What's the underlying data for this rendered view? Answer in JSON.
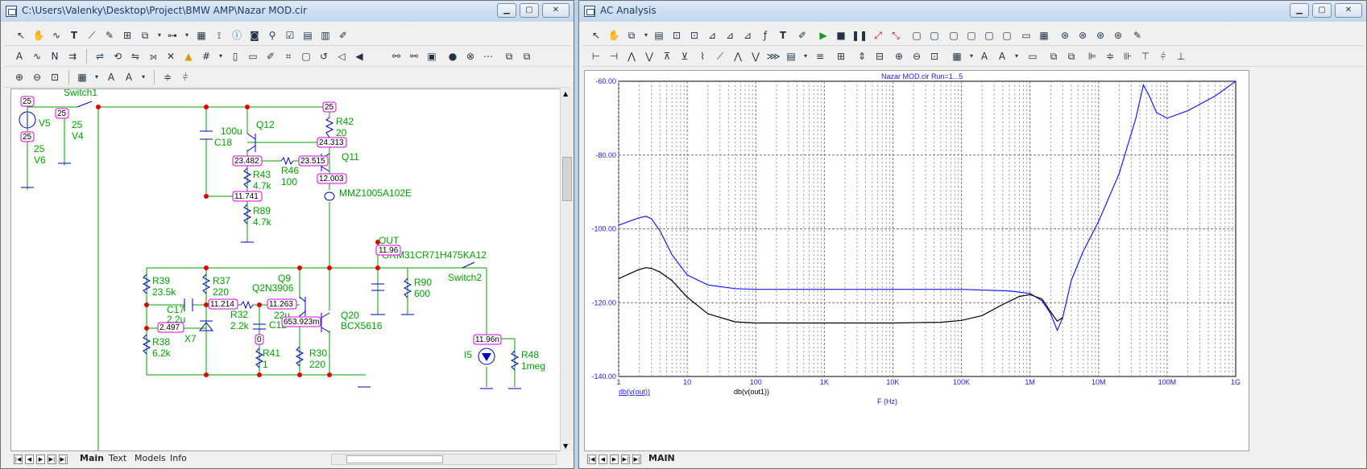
{
  "schematic": {
    "title": "C:\\Users\\Valenky\\Desktop\\Project\\BMW AMP\\Nazar MOD.cir",
    "tabs": [
      "Main",
      "Text",
      "Models",
      "Info"
    ],
    "components": {
      "switch1": "Switch1",
      "v5": "V5",
      "v5_val": "25",
      "v6": "V6",
      "v6_val": "25",
      "v4": "V4",
      "v4_val": "25",
      "c18": "C18",
      "c18_val": "100u",
      "q12": "Q12",
      "r42": "R42",
      "r42_val": "20",
      "q11": "Q11",
      "r43": "R43",
      "r43_val": "4.7k",
      "r46": "R46",
      "r46_val": "100",
      "r89": "R89",
      "r89_val": "4.7k",
      "mmz": "MMZ1005A102E",
      "out": "OUT",
      "grm": "GRM31CR71H475KA12",
      "switch2": "Switch2",
      "r39": "R39",
      "r39_val": "23.5k",
      "r37": "R37",
      "r37_val": "220",
      "q9": "Q9",
      "q9_model": "Q2N3906",
      "c17": "C17",
      "c17_val": "2.2u",
      "r32": "R32",
      "r32_val": "2.2k",
      "c12": "C12",
      "c12_val": "22u",
      "q20": "Q20",
      "q20_model": "BCX5616",
      "r90": "R90",
      "r90_val": "600",
      "x7": "X7",
      "r38": "R38",
      "r38_val": "6.2k",
      "r41": "R41",
      "r41_val": "1",
      "r30": "R30",
      "r30_val": "220",
      "i5": "I5",
      "r48": "R48",
      "r48_val": "1meg"
    },
    "node_labels": {
      "n_v5_top": "25",
      "n_v5_bot": "25",
      "n_v4": "25",
      "n_r42": "25",
      "n_q11c": "24.313",
      "n_q12b": "23.482",
      "n_q11b": "23.515",
      "n_q11e": "12.003",
      "n_r43": "11.741",
      "n_out": "11.96",
      "n_r37": "11.214",
      "n_q9b": "11.263",
      "n_x7": "2.497",
      "n_q20b": "653.923m",
      "n_r41": "0",
      "n_i5": "11.96n"
    }
  },
  "analysis": {
    "title": "AC Analysis",
    "tab": "MAIN",
    "chart_title": "Nazar MOD.cir Run=1...5",
    "legend_1": "db(v(out))",
    "legend_2": "db(v(out1))",
    "xlabel": "F (Hz)"
  },
  "chart_data": {
    "type": "line",
    "title": "Nazar MOD.cir Run=1...5",
    "xlabel": "F (Hz)",
    "ylabel": "",
    "xscale": "log",
    "xlim": [
      1,
      1000000000
    ],
    "ylim": [
      -140,
      -60
    ],
    "x_ticks": [
      "1",
      "10",
      "100",
      "1K",
      "10K",
      "100K",
      "1M",
      "10M",
      "100M",
      "1G"
    ],
    "y_ticks": [
      "-60.00",
      "-80.00",
      "-100.00",
      "-120.00",
      "-140.00"
    ],
    "grid": true,
    "series": [
      {
        "name": "db(v(out))",
        "color": "#1a1aff",
        "x": [
          1,
          1.5,
          2,
          2.5,
          3,
          4,
          6,
          10,
          20,
          50,
          100,
          1000,
          10000,
          100000,
          500000,
          1000000,
          1500000,
          2000000,
          2500000,
          3000000,
          4000000,
          6000000,
          10000000,
          20000000,
          35000000,
          45000000,
          55000000,
          70000000,
          100000000,
          200000000,
          500000000,
          1000000000
        ],
        "y": [
          -99,
          -97.8,
          -97,
          -96.6,
          -97.2,
          -100.5,
          -107,
          -112.5,
          -115.2,
          -116.2,
          -116.4,
          -116.4,
          -116.4,
          -116.4,
          -116.8,
          -117.5,
          -119.5,
          -123,
          -127.5,
          -124,
          -114,
          -106,
          -98,
          -85,
          -70,
          -61,
          -64,
          -68.5,
          -70,
          -68,
          -64,
          -60
        ]
      },
      {
        "name": "db(v(out1))",
        "color": "#000000",
        "x": [
          1,
          1.5,
          2,
          2.5,
          3,
          4,
          6,
          10,
          20,
          50,
          100,
          1000,
          10000,
          50000,
          100000,
          200000,
          400000,
          700000,
          1000000,
          1500000,
          2000000,
          2500000,
          3000000
        ],
        "y": [
          -113.5,
          -112,
          -111,
          -110.5,
          -110.7,
          -111.7,
          -114,
          -118.5,
          -123,
          -125.2,
          -125.5,
          -125.5,
          -125.5,
          -125.3,
          -124.8,
          -123.5,
          -120.5,
          -118.3,
          -117.8,
          -119,
          -122.5,
          -125,
          -124
        ]
      }
    ]
  }
}
